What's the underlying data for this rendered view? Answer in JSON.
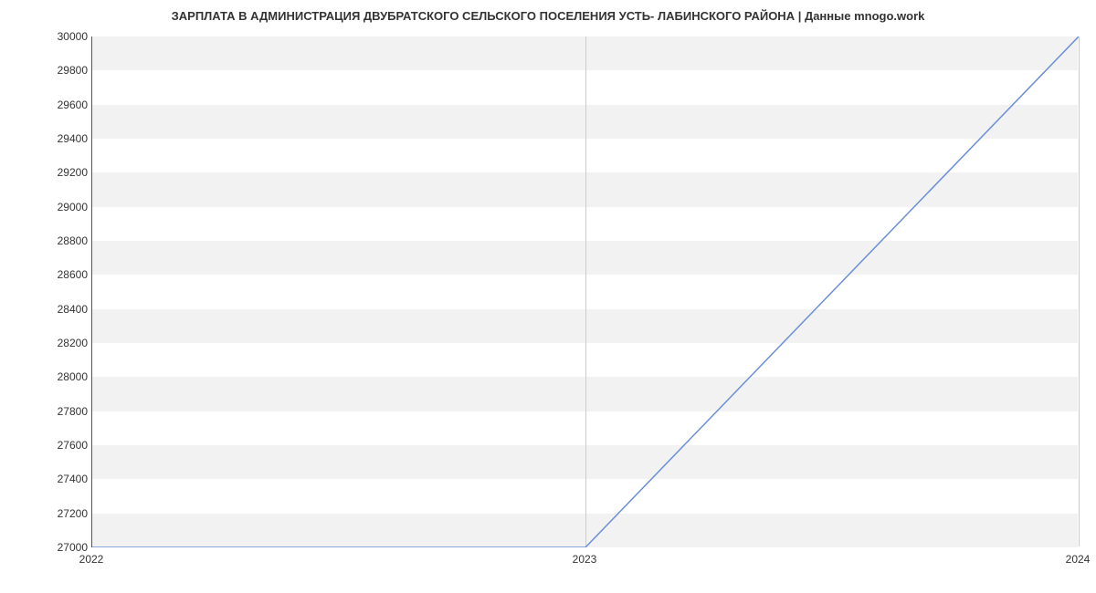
{
  "chart_data": {
    "type": "line",
    "title": "ЗАРПЛАТА В АДМИНИСТРАЦИЯ ДВУБРАТСКОГО СЕЛЬСКОГО ПОСЕЛЕНИЯ УСТЬ- ЛАБИНСКОГО РАЙОНА | Данные mnogo.work",
    "x": [
      2022,
      2023,
      2024
    ],
    "values": [
      27000,
      27000,
      30000
    ],
    "xlabel": "",
    "ylabel": "",
    "xlim": [
      2022,
      2024
    ],
    "ylim": [
      27000,
      30000
    ],
    "x_ticks": [
      2022,
      2023,
      2024
    ],
    "y_ticks": [
      27000,
      27200,
      27400,
      27600,
      27800,
      28000,
      28200,
      28400,
      28600,
      28800,
      29000,
      29200,
      29400,
      29600,
      29800,
      30000
    ],
    "line_color": "#6a8fd8"
  }
}
